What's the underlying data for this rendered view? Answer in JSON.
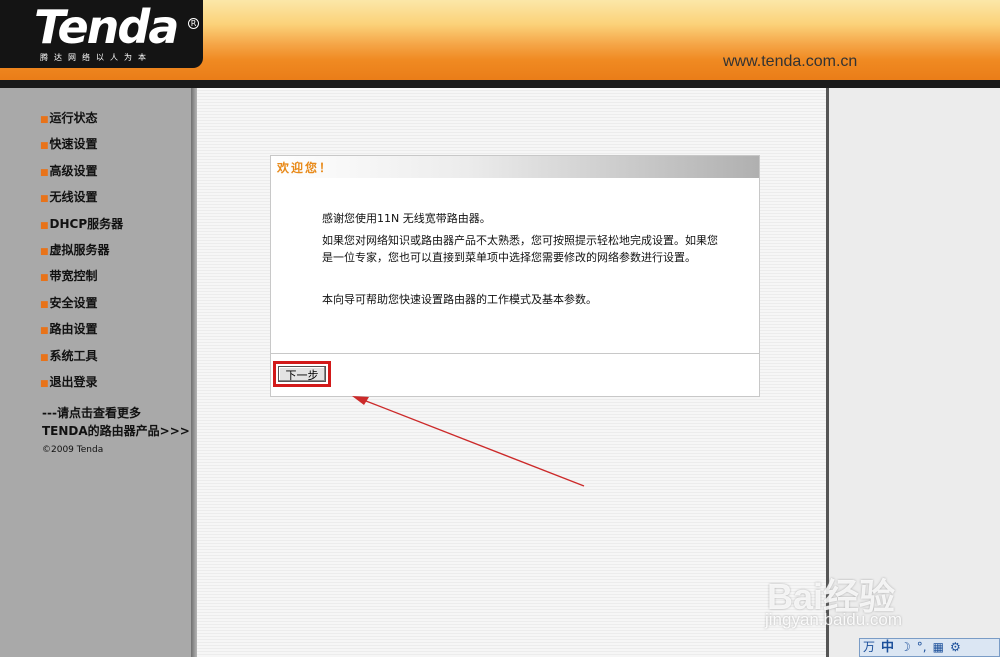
{
  "header": {
    "logo_text": "Tenda",
    "logo_slogan": "腾达网络以人为本",
    "url": "www.tenda.com.cn"
  },
  "sidebar": {
    "items": [
      {
        "label": "运行状态"
      },
      {
        "label": "快速设置"
      },
      {
        "label": "高级设置"
      },
      {
        "label": "无线设置"
      },
      {
        "label": "DHCP服务器"
      },
      {
        "label": "虚拟服务器"
      },
      {
        "label": "带宽控制"
      },
      {
        "label": "安全设置"
      },
      {
        "label": "路由设置"
      },
      {
        "label": "系统工具"
      },
      {
        "label": "退出登录"
      }
    ],
    "more_line1": "---请点击查看更多",
    "more_line2": "TENDA的路由器产品>>>",
    "copyright": "©2009 Tenda"
  },
  "wizard": {
    "title": "欢迎您！",
    "para1": "感谢您使用11N 无线宽带路由器。",
    "para2": "如果您对网络知识或路由器产品不太熟悉，您可按照提示轻松地完成设置。如果您是一位专家，您也可以直接到菜单项中选择您需要修改的网络参数进行设置。",
    "para3": "本向导可帮助您快速设置路由器的工作模式及基本参数。",
    "next_label": "下一步"
  },
  "watermark": {
    "brand": "Bai经验",
    "url": "jingyan.baidu.com"
  },
  "ime": {
    "mode": "中",
    "symbols": [
      "万",
      "☽",
      "°,",
      "▦",
      "⚙"
    ]
  },
  "colors": {
    "accent_orange": "#e88a1a",
    "highlight_red": "#d21a1a",
    "arrow_red": "#cc2a2a"
  }
}
